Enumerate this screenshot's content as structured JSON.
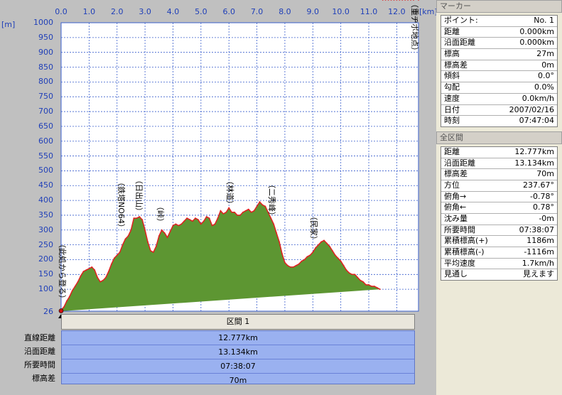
{
  "chart_data": {
    "type": "area",
    "x_unit": "[km]",
    "y_unit": "[m]",
    "x_ticks": [
      "0.0",
      "1.0",
      "2.0",
      "3.0",
      "4.0",
      "5.0",
      "6.0",
      "7.0",
      "8.0",
      "9.0",
      "10.0",
      "11.0",
      "12.0"
    ],
    "y_ticks": [
      "1000",
      "950",
      "900",
      "850",
      "800",
      "750",
      "700",
      "650",
      "600",
      "550",
      "500",
      "450",
      "400",
      "350",
      "300",
      "250",
      "200",
      "150",
      "100"
    ],
    "y_min_label": "26",
    "xlim": [
      0,
      12.777
    ],
    "ylim": [
      26,
      1000
    ],
    "fill_color": "#5d9632",
    "line_color": "#e02020",
    "x": [
      0,
      0.05,
      0.1,
      0.2,
      0.3,
      0.4,
      0.5,
      0.6,
      0.7,
      0.8,
      0.9,
      1.0,
      1.1,
      1.2,
      1.3,
      1.4,
      1.5,
      1.6,
      1.7,
      1.8,
      1.9,
      2.0,
      2.1,
      2.2,
      2.3,
      2.4,
      2.5,
      2.6,
      2.7,
      2.8,
      2.9,
      3.0,
      3.1,
      3.2,
      3.3,
      3.4,
      3.5,
      3.6,
      3.7,
      3.8,
      3.9,
      4.0,
      4.1,
      4.2,
      4.3,
      4.4,
      4.5,
      4.6,
      4.7,
      4.8,
      4.9,
      5.0,
      5.1,
      5.2,
      5.3,
      5.4,
      5.5,
      5.6,
      5.7,
      5.8,
      5.9,
      6.0,
      6.1,
      6.2,
      6.3,
      6.4,
      6.5,
      6.6,
      6.7,
      6.8,
      6.9,
      7.0,
      7.1,
      7.2,
      7.3,
      7.4,
      7.5,
      7.6,
      7.7,
      7.8,
      7.9,
      8.0,
      8.1,
      8.2,
      8.3,
      8.4,
      8.5,
      8.6,
      8.7,
      8.8,
      8.9,
      9.0,
      9.1,
      9.2,
      9.3,
      9.4,
      9.5,
      9.6,
      9.7,
      9.8,
      9.9,
      10.0,
      10.1,
      10.2,
      10.3,
      10.4,
      10.5,
      10.6,
      10.7,
      10.8,
      10.9,
      11.0,
      11.1,
      11.2,
      11.3,
      11.4,
      11.5,
      11.6,
      11.7,
      11.8,
      11.9,
      12.0,
      12.1,
      12.2,
      12.3,
      12.4,
      12.5,
      12.6,
      12.777
    ],
    "y": [
      27,
      35,
      40,
      60,
      75,
      95,
      110,
      125,
      145,
      160,
      165,
      170,
      175,
      165,
      140,
      125,
      130,
      140,
      160,
      185,
      205,
      215,
      225,
      250,
      270,
      280,
      300,
      340,
      340,
      345,
      335,
      300,
      260,
      230,
      225,
      245,
      280,
      300,
      290,
      275,
      295,
      315,
      320,
      315,
      320,
      330,
      340,
      335,
      330,
      340,
      335,
      320,
      330,
      345,
      340,
      315,
      320,
      340,
      365,
      355,
      360,
      375,
      360,
      360,
      350,
      350,
      360,
      365,
      370,
      360,
      365,
      380,
      395,
      385,
      380,
      360,
      340,
      320,
      290,
      260,
      220,
      190,
      180,
      175,
      175,
      180,
      185,
      195,
      200,
      210,
      215,
      225,
      240,
      250,
      260,
      265,
      255,
      245,
      230,
      215,
      205,
      195,
      180,
      165,
      155,
      150,
      150,
      140,
      130,
      125,
      115,
      115,
      110,
      110,
      105,
      100
    ],
    "annotations": [
      {
        "text": "（此処から登る）",
        "x": 0.1
      },
      {
        "text": "（鉄塔NO64）",
        "x": 2.2
      },
      {
        "text": "（日出山）",
        "x": 2.85
      },
      {
        "text": "（峠）",
        "x": 3.6
      },
      {
        "text": "（林道）",
        "x": 6.1
      },
      {
        "text": "（二秀峰）",
        "x": 7.6
      },
      {
        "text": "（民家）",
        "x": 9.1
      },
      {
        "text": "（重ヂボ地点）",
        "x": 12.7
      }
    ]
  },
  "section": {
    "title": "区間 1",
    "rows": [
      {
        "label": "直線距離",
        "value": "12.777km"
      },
      {
        "label": "沿面距離",
        "value": "13.134km"
      },
      {
        "label": "所要時間",
        "value": "07:38:07"
      },
      {
        "label": "標高差",
        "value": "70m"
      }
    ]
  },
  "marker": {
    "title": "マーカー",
    "rows": [
      {
        "label": "ポイント:",
        "value": "No. 1"
      },
      {
        "label": "距離",
        "value": "0.000km"
      },
      {
        "label": "沿面距離",
        "value": "0.000km"
      },
      {
        "label": "標高",
        "value": "27m"
      },
      {
        "label": "標高差",
        "value": "0m"
      },
      {
        "label": "傾斜",
        "value": "0.0°"
      },
      {
        "label": "勾配",
        "value": "0.0%"
      },
      {
        "label": "速度",
        "value": "0.0km/h"
      },
      {
        "label": "日付",
        "value": "2007/02/16"
      },
      {
        "label": "時刻",
        "value": "07:47:04"
      }
    ]
  },
  "all_sections": {
    "title": "全区間",
    "rows": [
      {
        "label": "距離",
        "value": "12.777km"
      },
      {
        "label": "沿面距離",
        "value": "13.134km"
      },
      {
        "label": "標高差",
        "value": "70m"
      },
      {
        "label": "方位",
        "value": "237.67°"
      },
      {
        "label": "俯角→",
        "value": "-0.78°"
      },
      {
        "label": "俯角←",
        "value": "0.78°"
      },
      {
        "label": "沈み量",
        "value": "-0m"
      },
      {
        "label": "所要時間",
        "value": "07:38:07"
      },
      {
        "label": "累積標高(+)",
        "value": "1186m"
      },
      {
        "label": "累積標高(-)",
        "value": "-1116m"
      },
      {
        "label": "平均速度",
        "value": "1.7km/h"
      },
      {
        "label": "見通し",
        "value": "見えます"
      }
    ]
  }
}
